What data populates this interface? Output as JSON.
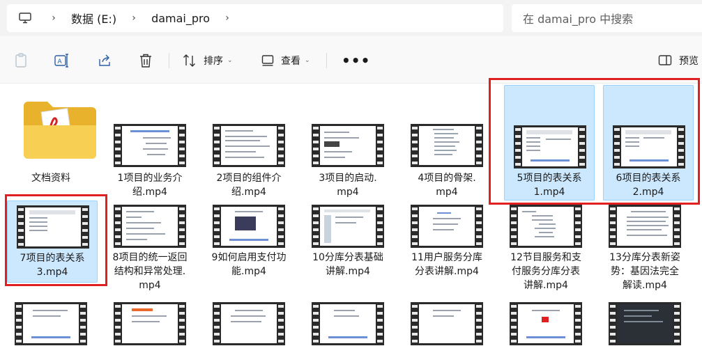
{
  "address": {
    "crumbs": [
      "数据 (E:)",
      "damai_pro"
    ],
    "search_placeholder": "在 damai_pro 中搜索"
  },
  "toolbar": {
    "sort_label": "排序",
    "view_label": "查看",
    "more_label": "•••",
    "preview_label": "预览"
  },
  "files": [
    {
      "name": "文档资料",
      "kind": "folder"
    },
    {
      "name": "1项目的业务介\n绍.mp4",
      "kind": "video"
    },
    {
      "name": "2项目的组件介\n绍.mp4",
      "kind": "video"
    },
    {
      "name": "3项目的启动.\nmp4",
      "kind": "video"
    },
    {
      "name": "4项目的骨架.\nmp4",
      "kind": "video"
    },
    {
      "name": "5项目的表关系\n1.mp4",
      "kind": "video",
      "selected": true
    },
    {
      "name": "6项目的表关系\n2.mp4",
      "kind": "video",
      "selected": true
    },
    {
      "name": "7项目的表关系\n3.mp4",
      "kind": "video",
      "selected": true
    },
    {
      "name": "8项目的统一返回\n结构和异常处理.\nmp4",
      "kind": "video"
    },
    {
      "name": "9如何启用支付功\n能.mp4",
      "kind": "video"
    },
    {
      "name": "10分库分表基础\n讲解.mp4",
      "kind": "video"
    },
    {
      "name": "11用户服务分库\n分表讲解.mp4",
      "kind": "video"
    },
    {
      "name": "12节目服务和支\n付服务分库分表\n讲解.mp4",
      "kind": "video"
    },
    {
      "name": "13分库分表新姿\n势：基因法完全\n解读.mp4",
      "kind": "video"
    }
  ],
  "colors": {
    "selection_fill": "#cce8ff",
    "annotation_red": "#e02020",
    "folder_yellow": "#f5c842"
  }
}
